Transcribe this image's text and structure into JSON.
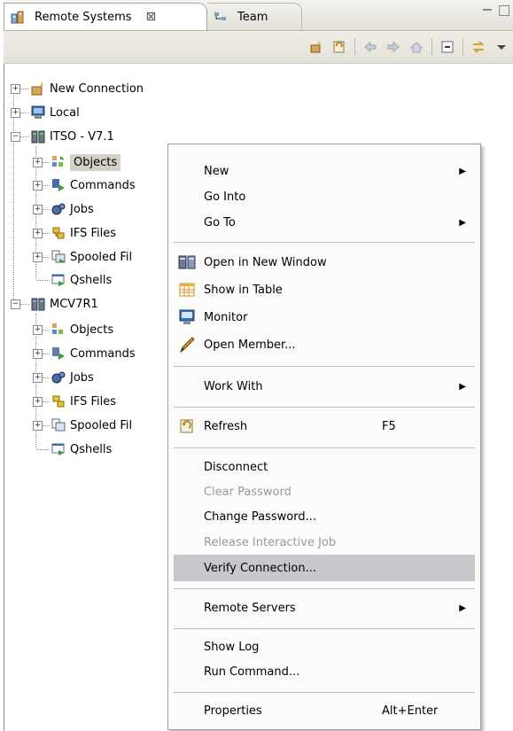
{
  "tabs": [
    {
      "label": "Remote Systems",
      "close": "⊠"
    },
    {
      "label": "Team"
    }
  ],
  "toolbar": {
    "icons": [
      "new-connection-icon",
      "refresh-icon",
      "back-icon",
      "forward-icon",
      "home-icon",
      "collapse-all-icon",
      "link-with-editor-icon",
      "view-menu-icon"
    ]
  },
  "tree": [
    {
      "label": "New Connection"
    },
    {
      "label": "Local"
    },
    {
      "label": "ITSO - V7.1",
      "children": [
        {
          "label": "Objects"
        },
        {
          "label": "Commands"
        },
        {
          "label": "Jobs"
        },
        {
          "label": "IFS Files"
        },
        {
          "label": "Spooled Fil"
        },
        {
          "label": "Qshells"
        }
      ]
    },
    {
      "label": "MCV7R1",
      "children": [
        {
          "label": "Objects"
        },
        {
          "label": "Commands"
        },
        {
          "label": "Jobs"
        },
        {
          "label": "IFS Files"
        },
        {
          "label": "Spooled Fil"
        },
        {
          "label": "Qshells"
        }
      ]
    }
  ],
  "menu": {
    "items": [
      {
        "label": "New",
        "arrow": "▶"
      },
      {
        "label": "Go Into"
      },
      {
        "label": "Go To",
        "arrow": "▶"
      },
      {
        "label": "Open in New Window",
        "icon": "window-icon"
      },
      {
        "label": "Show in Table",
        "icon": "table-icon"
      },
      {
        "label": "Monitor",
        "icon": "monitor-icon"
      },
      {
        "label": "Open Member...",
        "icon": "pencil-icon"
      },
      {
        "label": "Work With",
        "arrow": "▶"
      },
      {
        "label": "Refresh",
        "shortcut": "F5",
        "icon": "refresh-icon"
      },
      {
        "label": "Disconnect"
      },
      {
        "label": "Clear Password",
        "disabled": true
      },
      {
        "label": "Change Password..."
      },
      {
        "label": "Release Interactive Job",
        "disabled": true
      },
      {
        "label": "Verify Connection...",
        "highlighted": true
      },
      {
        "label": "Remote Servers",
        "arrow": "▶"
      },
      {
        "label": "Show Log"
      },
      {
        "label": "Run Command..."
      },
      {
        "label": "Properties",
        "shortcut": "Alt+Enter"
      }
    ]
  },
  "colors": {
    "highlight": "#c8c8cc",
    "selected": "#d4d0c8",
    "disabled": "#9a9a9a"
  }
}
